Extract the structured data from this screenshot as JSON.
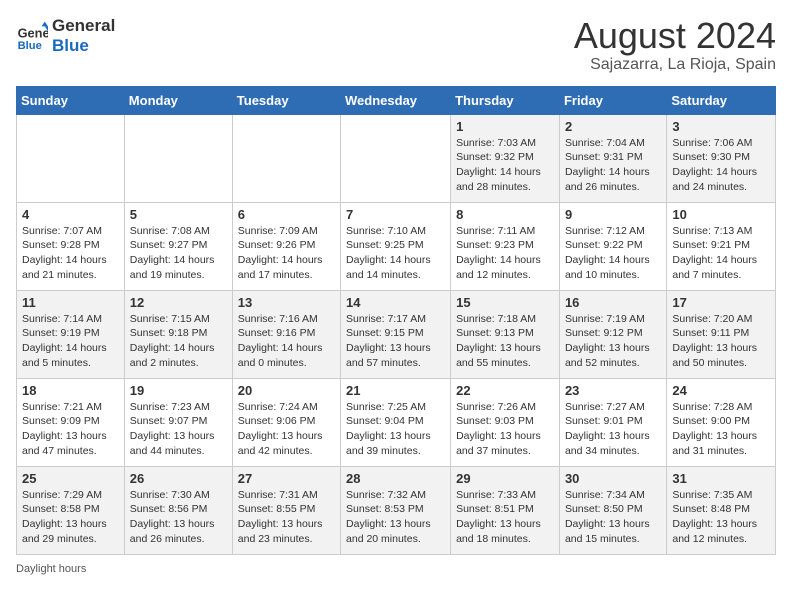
{
  "header": {
    "logo_line1": "General",
    "logo_line2": "Blue",
    "month_title": "August 2024",
    "location": "Sajazarra, La Rioja, Spain"
  },
  "days_of_week": [
    "Sunday",
    "Monday",
    "Tuesday",
    "Wednesday",
    "Thursday",
    "Friday",
    "Saturday"
  ],
  "weeks": [
    [
      {
        "day": "",
        "info": ""
      },
      {
        "day": "",
        "info": ""
      },
      {
        "day": "",
        "info": ""
      },
      {
        "day": "",
        "info": ""
      },
      {
        "day": "1",
        "info": "Sunrise: 7:03 AM\nSunset: 9:32 PM\nDaylight: 14 hours\nand 28 minutes."
      },
      {
        "day": "2",
        "info": "Sunrise: 7:04 AM\nSunset: 9:31 PM\nDaylight: 14 hours\nand 26 minutes."
      },
      {
        "day": "3",
        "info": "Sunrise: 7:06 AM\nSunset: 9:30 PM\nDaylight: 14 hours\nand 24 minutes."
      }
    ],
    [
      {
        "day": "4",
        "info": "Sunrise: 7:07 AM\nSunset: 9:28 PM\nDaylight: 14 hours\nand 21 minutes."
      },
      {
        "day": "5",
        "info": "Sunrise: 7:08 AM\nSunset: 9:27 PM\nDaylight: 14 hours\nand 19 minutes."
      },
      {
        "day": "6",
        "info": "Sunrise: 7:09 AM\nSunset: 9:26 PM\nDaylight: 14 hours\nand 17 minutes."
      },
      {
        "day": "7",
        "info": "Sunrise: 7:10 AM\nSunset: 9:25 PM\nDaylight: 14 hours\nand 14 minutes."
      },
      {
        "day": "8",
        "info": "Sunrise: 7:11 AM\nSunset: 9:23 PM\nDaylight: 14 hours\nand 12 minutes."
      },
      {
        "day": "9",
        "info": "Sunrise: 7:12 AM\nSunset: 9:22 PM\nDaylight: 14 hours\nand 10 minutes."
      },
      {
        "day": "10",
        "info": "Sunrise: 7:13 AM\nSunset: 9:21 PM\nDaylight: 14 hours\nand 7 minutes."
      }
    ],
    [
      {
        "day": "11",
        "info": "Sunrise: 7:14 AM\nSunset: 9:19 PM\nDaylight: 14 hours\nand 5 minutes."
      },
      {
        "day": "12",
        "info": "Sunrise: 7:15 AM\nSunset: 9:18 PM\nDaylight: 14 hours\nand 2 minutes."
      },
      {
        "day": "13",
        "info": "Sunrise: 7:16 AM\nSunset: 9:16 PM\nDaylight: 14 hours\nand 0 minutes."
      },
      {
        "day": "14",
        "info": "Sunrise: 7:17 AM\nSunset: 9:15 PM\nDaylight: 13 hours\nand 57 minutes."
      },
      {
        "day": "15",
        "info": "Sunrise: 7:18 AM\nSunset: 9:13 PM\nDaylight: 13 hours\nand 55 minutes."
      },
      {
        "day": "16",
        "info": "Sunrise: 7:19 AM\nSunset: 9:12 PM\nDaylight: 13 hours\nand 52 minutes."
      },
      {
        "day": "17",
        "info": "Sunrise: 7:20 AM\nSunset: 9:11 PM\nDaylight: 13 hours\nand 50 minutes."
      }
    ],
    [
      {
        "day": "18",
        "info": "Sunrise: 7:21 AM\nSunset: 9:09 PM\nDaylight: 13 hours\nand 47 minutes."
      },
      {
        "day": "19",
        "info": "Sunrise: 7:23 AM\nSunset: 9:07 PM\nDaylight: 13 hours\nand 44 minutes."
      },
      {
        "day": "20",
        "info": "Sunrise: 7:24 AM\nSunset: 9:06 PM\nDaylight: 13 hours\nand 42 minutes."
      },
      {
        "day": "21",
        "info": "Sunrise: 7:25 AM\nSunset: 9:04 PM\nDaylight: 13 hours\nand 39 minutes."
      },
      {
        "day": "22",
        "info": "Sunrise: 7:26 AM\nSunset: 9:03 PM\nDaylight: 13 hours\nand 37 minutes."
      },
      {
        "day": "23",
        "info": "Sunrise: 7:27 AM\nSunset: 9:01 PM\nDaylight: 13 hours\nand 34 minutes."
      },
      {
        "day": "24",
        "info": "Sunrise: 7:28 AM\nSunset: 9:00 PM\nDaylight: 13 hours\nand 31 minutes."
      }
    ],
    [
      {
        "day": "25",
        "info": "Sunrise: 7:29 AM\nSunset: 8:58 PM\nDaylight: 13 hours\nand 29 minutes."
      },
      {
        "day": "26",
        "info": "Sunrise: 7:30 AM\nSunset: 8:56 PM\nDaylight: 13 hours\nand 26 minutes."
      },
      {
        "day": "27",
        "info": "Sunrise: 7:31 AM\nSunset: 8:55 PM\nDaylight: 13 hours\nand 23 minutes."
      },
      {
        "day": "28",
        "info": "Sunrise: 7:32 AM\nSunset: 8:53 PM\nDaylight: 13 hours\nand 20 minutes."
      },
      {
        "day": "29",
        "info": "Sunrise: 7:33 AM\nSunset: 8:51 PM\nDaylight: 13 hours\nand 18 minutes."
      },
      {
        "day": "30",
        "info": "Sunrise: 7:34 AM\nSunset: 8:50 PM\nDaylight: 13 hours\nand 15 minutes."
      },
      {
        "day": "31",
        "info": "Sunrise: 7:35 AM\nSunset: 8:48 PM\nDaylight: 13 hours\nand 12 minutes."
      }
    ]
  ],
  "footer": {
    "daylight_label": "Daylight hours"
  }
}
